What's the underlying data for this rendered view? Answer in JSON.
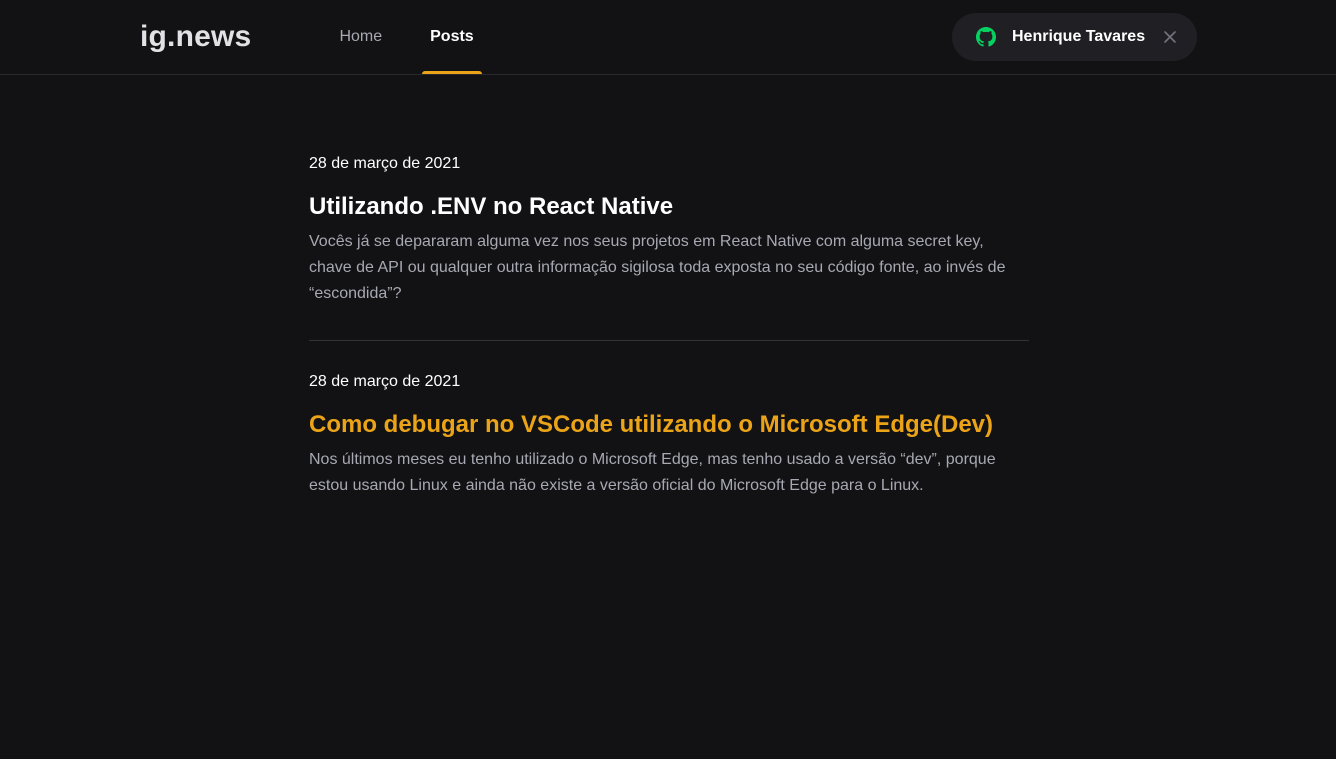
{
  "header": {
    "logo": "ig.news",
    "nav": [
      {
        "label": "Home",
        "active": false
      },
      {
        "label": "Posts",
        "active": true
      }
    ],
    "user": {
      "name": "Henrique Tavares",
      "icon": "github-icon",
      "close_icon": "close-icon"
    }
  },
  "colors": {
    "background": "#121214",
    "accent": "#eba417",
    "github_green": "#04d361",
    "button_bg": "#202024",
    "muted_text": "#a8a8b3"
  },
  "posts": [
    {
      "date": "28 de março de 2021",
      "title": "Utilizando .ENV no React Native",
      "excerpt": "Vocês já se depararam alguma vez nos seus projetos em React Native com alguma secret key, chave de API ou qualquer outra informação sigilosa toda exposta no seu código fonte, ao invés de “escondida”?"
    },
    {
      "date": "28 de março de 2021",
      "title": "Como debugar no VSCode utilizando o Microsoft Edge(Dev)",
      "excerpt": "Nos últimos meses eu tenho utilizado o Microsoft Edge, mas tenho usado a versão “dev”, porque estou usando Linux e ainda não existe a versão oficial do Microsoft Edge para o Linux."
    }
  ]
}
